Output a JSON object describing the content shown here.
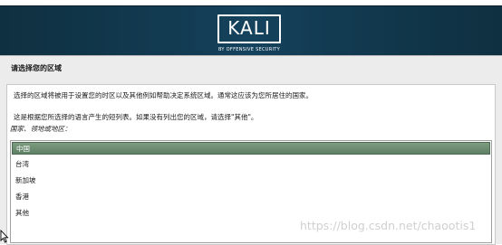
{
  "brand": {
    "logo_text": "KALI",
    "logo_subtext": "BY OFFENSIVE SECURITY"
  },
  "page": {
    "title": "请选择您的区域"
  },
  "description": {
    "line1": "选择的区域将被用于设置您的时区以及其他例如帮助决定系统区域。通常这应该为您所居住的国家。",
    "line2": "这是根据您所选择的语言产生的短列表。如果没有列出您的区域，请选择\"其他\"。"
  },
  "location_list": {
    "label": "国家、领地或地区：",
    "selected": "中国",
    "items": [
      "中国",
      "台湾",
      "新加坡",
      "香港",
      "其他"
    ]
  },
  "watermark": "https://blog.csdn.net/chaootis1",
  "colors": {
    "banner": "#15425d",
    "selection": "#6b8c70"
  }
}
